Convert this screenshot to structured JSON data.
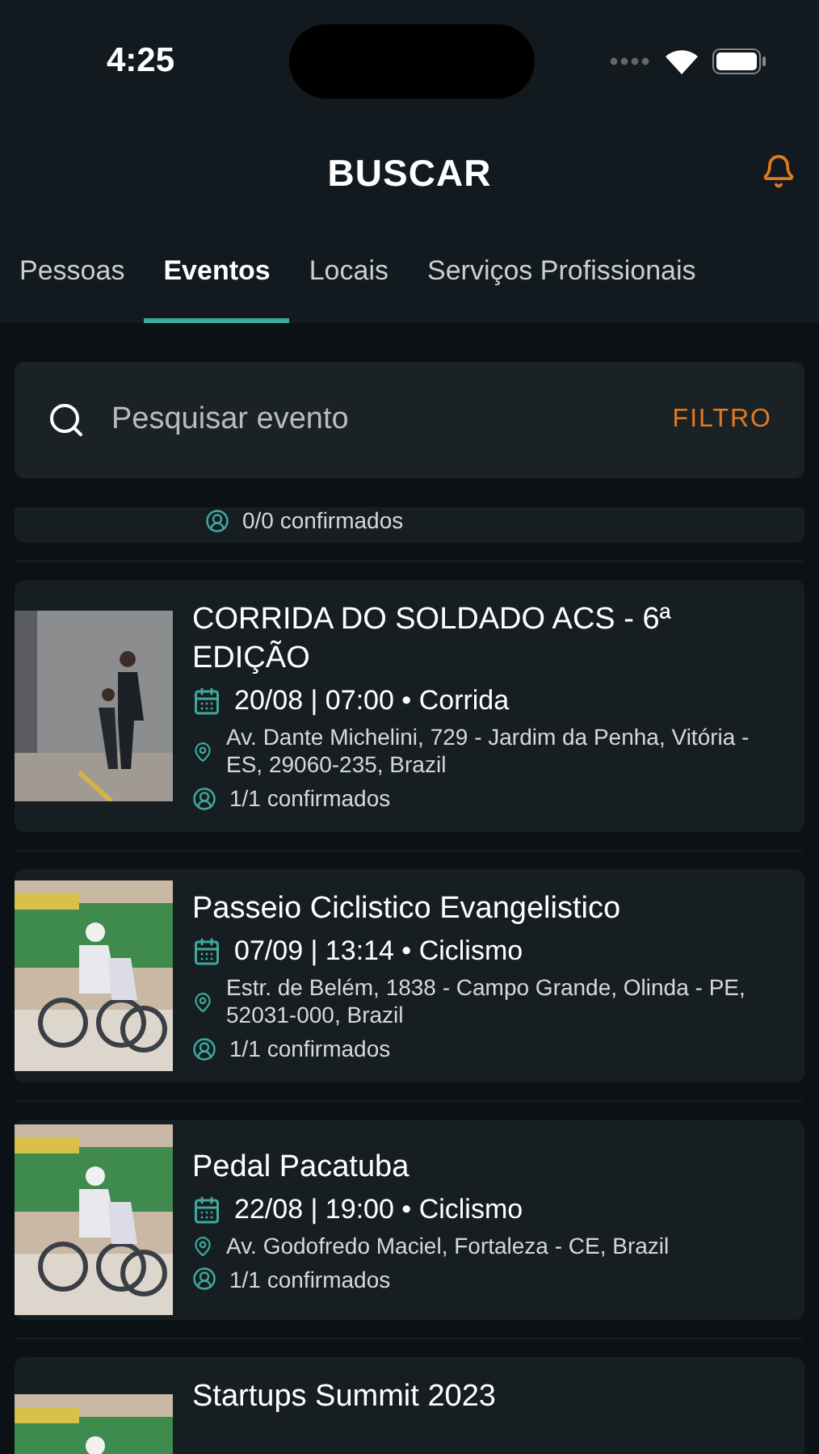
{
  "status_bar": {
    "time": "4:25"
  },
  "header": {
    "title": "BUSCAR"
  },
  "tabs": [
    {
      "label": "Pessoas",
      "selected": false
    },
    {
      "label": "Eventos",
      "selected": true
    },
    {
      "label": "Locais",
      "selected": false
    },
    {
      "label": "Serviços Profissionais",
      "selected": false
    }
  ],
  "search": {
    "placeholder": "Pesquisar evento",
    "filter": "FILTRO"
  },
  "events": [
    {
      "confirmed": "0/0 confirmados"
    },
    {
      "title": "CORRIDA DO SOLDADO ACS - 6ª EDIÇÃO",
      "date": "20/08 | 07:00 • Corrida",
      "address": "Av. Dante Michelini, 729 - Jardim da Penha, Vitória - ES, 29060-235, Brazil",
      "confirmed": "1/1 confirmados",
      "kind": "picture"
    },
    {
      "title": "Passeio Ciclistico Evangelistico",
      "date": "07/09 | 13:14 • Ciclismo",
      "address": "Estr. de Belém, 1838 - Campo Grande, Olinda - PE, 52031-000, Brazil",
      "confirmed": "1/1 confirmados",
      "kind": "picture"
    },
    {
      "title": "Pedal Pacatuba",
      "date": "22/08 | 19:00 • Ciclismo",
      "address": "Av. Godofredo Maciel, Fortaleza - CE, Brazil",
      "confirmed": "1/1 confirmados",
      "kind": "picture"
    },
    {
      "title": "Startups Summit 2023",
      "kind": "picture"
    }
  ]
}
